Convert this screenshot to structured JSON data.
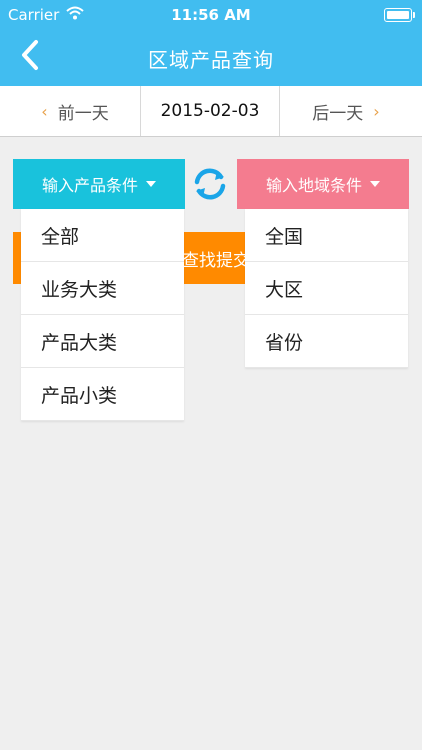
{
  "status": {
    "carrier": "Carrier",
    "time": "11:56 AM"
  },
  "header": {
    "title": "区域产品查询"
  },
  "datebar": {
    "prev": "前一天",
    "date": "2015-02-03",
    "next": "后一天"
  },
  "conditions": {
    "product": "输入产品条件",
    "region": "输入地域条件"
  },
  "submit": {
    "label": "查找提交"
  },
  "product_dropdown": [
    "全部",
    "业务大类",
    "产品大类",
    "产品小类"
  ],
  "region_dropdown": [
    "全国",
    "大区",
    "省份"
  ],
  "colors": {
    "header": "#41bdf0",
    "product_btn": "#19c2dc",
    "region_btn": "#f47c8f",
    "submit": "#ff8a00",
    "chevron": "#e8a14a"
  }
}
